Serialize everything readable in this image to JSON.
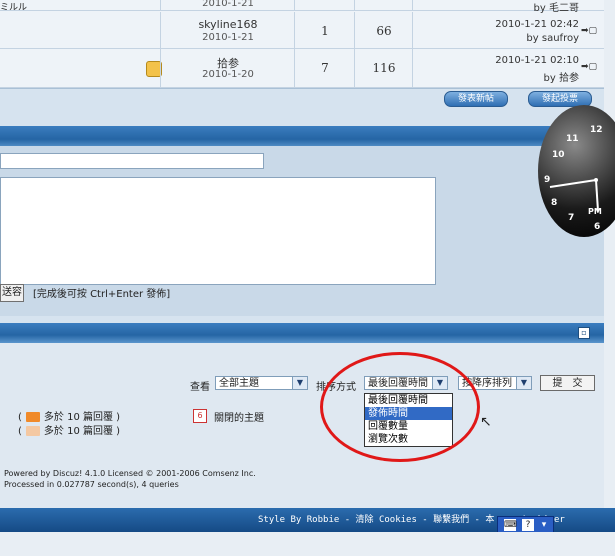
{
  "threads": [
    {
      "author": "",
      "author_date": "2010-1-21",
      "replies": "",
      "views": "",
      "last_time": "",
      "last_by": "by 毛二哥"
    },
    {
      "author": "skyline168",
      "author_date": "2010-1-21",
      "replies": "1",
      "views": "66",
      "last_time": "2010-1-21 02:42",
      "last_by": "by saufroy"
    },
    {
      "author": "拾参",
      "author_date": "2010-1-20",
      "replies": "7",
      "views": "116",
      "last_time": "2010-1-21 02:10",
      "last_by": "by 拾参"
    }
  ],
  "top_left_fragment": "ミルル",
  "buttons": {
    "new_thread": "發表新帖",
    "new_poll": "發起投票"
  },
  "reply": {
    "submit_label": "送容",
    "hint": "[完成後可按 Ctrl+Enter 發佈]"
  },
  "filters": {
    "view_label": "查看",
    "view_value": "全部主題",
    "sort_label": "排序方式",
    "sort_value": "最後回覆時間",
    "order_value": "按降序排列",
    "submit_label": "提　交",
    "sort_options": [
      "最後回覆時間",
      "發佈時間",
      "回覆數量",
      "瀏覽次數"
    ],
    "sort_highlighted": "發佈時間"
  },
  "legend": {
    "hot1": "多於 10 篇回覆 )",
    "hot2": "多於 10 篇回覆 )",
    "closed": "關閉的主題"
  },
  "footer": {
    "powered": "Powered by Discuz! 4.1.0 Licensed © 2001-2006 Comsenz Inc.",
    "processed": "Processed in 0.027787 second(s), 4 queries",
    "links": "Style By Robbie - 清除 Cookies - 聯繫我們 - 本 ... Archiver"
  },
  "clock_numbers": [
    "12",
    "11",
    "10",
    "9",
    "8",
    "7",
    "6"
  ],
  "clock_pm": "PM",
  "colors": {
    "band": "#2565a4",
    "highlight": "#316ac5",
    "ellipse": "#e01818"
  }
}
